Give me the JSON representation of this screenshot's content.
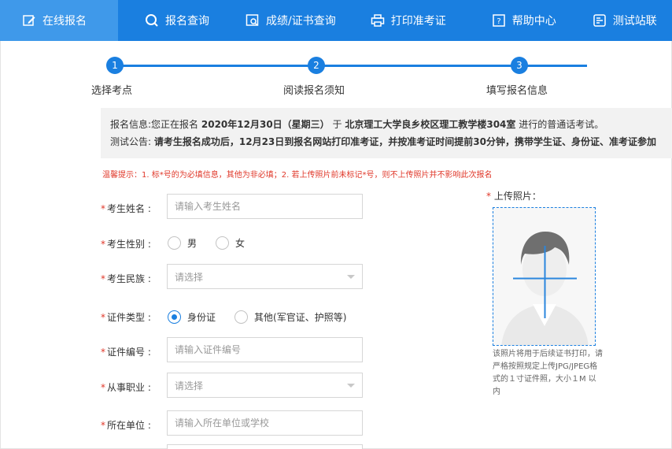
{
  "nav": {
    "items": [
      {
        "label": "在线报名",
        "icon": "edit-icon"
      },
      {
        "label": "报名查询",
        "icon": "search-icon"
      },
      {
        "label": "成绩/证书查询",
        "icon": "certificate-search-icon"
      },
      {
        "label": "打印准考证",
        "icon": "printer-icon"
      },
      {
        "label": "帮助中心",
        "icon": "help-icon"
      },
      {
        "label": "测试站联",
        "icon": "contact-icon"
      }
    ],
    "active_color": "#3f99ea",
    "bar_color": "#1a7fe0"
  },
  "steps": [
    {
      "number": "1",
      "label": "选择考点"
    },
    {
      "number": "2",
      "label": "阅读报名须知"
    },
    {
      "number": "3",
      "label": "填写报名信息"
    }
  ],
  "info": {
    "row1_prefix": "报名信息:您正在报名",
    "row1_date": "2020年12月30日（星期三）",
    "row1_mid": "于",
    "row1_place": "北京理工大学良乡校区理工教学楼304室",
    "row1_suffix": "进行的普通话考试。",
    "row2_prefix": "测试公告:",
    "row2_text": "请考生报名成功后，12月23日到报名网站打印准考证，并按准考证时间提前30分钟，携带学生证、身份证、准考证参加"
  },
  "tip": "温馨提示：1. 标*号的为必填信息，其他为非必填；2. 若上传照片前未标记*号，则不上传照片并不影响此次报名",
  "form": {
    "name": {
      "label": "考生姓名 :",
      "placeholder": "请输入考生姓名"
    },
    "gender": {
      "label": "考生性别 :",
      "options": [
        "男",
        "女"
      ]
    },
    "ethnicity": {
      "label": "考生民族 :",
      "placeholder": "请选择"
    },
    "id_type": {
      "label": "证件类型 :",
      "options": [
        "身份证",
        "其他(军官证、护照等)"
      ],
      "selected": "身份证"
    },
    "id_number": {
      "label": "证件编号 :",
      "placeholder": "请输入证件编号"
    },
    "occupation": {
      "label": "从事职业 :",
      "placeholder": "请选择"
    },
    "organization": {
      "label": "所在单位 :",
      "placeholder": "请输入所在单位或学校"
    }
  },
  "photo": {
    "label": "上传照片：",
    "note": "该照片将用于后续证书打印，请严格按照规定上传JPG/JPEG格式的１寸证件照，大小１M 以内"
  }
}
